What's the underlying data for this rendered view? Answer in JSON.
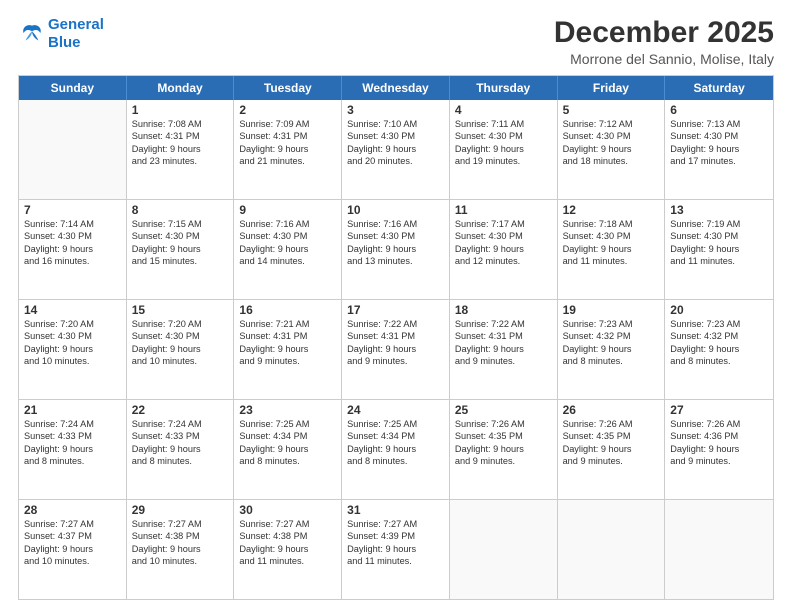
{
  "logo": {
    "line1": "General",
    "line2": "Blue"
  },
  "title": "December 2025",
  "subtitle": "Morrone del Sannio, Molise, Italy",
  "days_header": [
    "Sunday",
    "Monday",
    "Tuesday",
    "Wednesday",
    "Thursday",
    "Friday",
    "Saturday"
  ],
  "weeks": [
    [
      {
        "day": "",
        "lines": []
      },
      {
        "day": "1",
        "lines": [
          "Sunrise: 7:08 AM",
          "Sunset: 4:31 PM",
          "Daylight: 9 hours",
          "and 23 minutes."
        ]
      },
      {
        "day": "2",
        "lines": [
          "Sunrise: 7:09 AM",
          "Sunset: 4:31 PM",
          "Daylight: 9 hours",
          "and 21 minutes."
        ]
      },
      {
        "day": "3",
        "lines": [
          "Sunrise: 7:10 AM",
          "Sunset: 4:30 PM",
          "Daylight: 9 hours",
          "and 20 minutes."
        ]
      },
      {
        "day": "4",
        "lines": [
          "Sunrise: 7:11 AM",
          "Sunset: 4:30 PM",
          "Daylight: 9 hours",
          "and 19 minutes."
        ]
      },
      {
        "day": "5",
        "lines": [
          "Sunrise: 7:12 AM",
          "Sunset: 4:30 PM",
          "Daylight: 9 hours",
          "and 18 minutes."
        ]
      },
      {
        "day": "6",
        "lines": [
          "Sunrise: 7:13 AM",
          "Sunset: 4:30 PM",
          "Daylight: 9 hours",
          "and 17 minutes."
        ]
      }
    ],
    [
      {
        "day": "7",
        "lines": [
          "Sunrise: 7:14 AM",
          "Sunset: 4:30 PM",
          "Daylight: 9 hours",
          "and 16 minutes."
        ]
      },
      {
        "day": "8",
        "lines": [
          "Sunrise: 7:15 AM",
          "Sunset: 4:30 PM",
          "Daylight: 9 hours",
          "and 15 minutes."
        ]
      },
      {
        "day": "9",
        "lines": [
          "Sunrise: 7:16 AM",
          "Sunset: 4:30 PM",
          "Daylight: 9 hours",
          "and 14 minutes."
        ]
      },
      {
        "day": "10",
        "lines": [
          "Sunrise: 7:16 AM",
          "Sunset: 4:30 PM",
          "Daylight: 9 hours",
          "and 13 minutes."
        ]
      },
      {
        "day": "11",
        "lines": [
          "Sunrise: 7:17 AM",
          "Sunset: 4:30 PM",
          "Daylight: 9 hours",
          "and 12 minutes."
        ]
      },
      {
        "day": "12",
        "lines": [
          "Sunrise: 7:18 AM",
          "Sunset: 4:30 PM",
          "Daylight: 9 hours",
          "and 11 minutes."
        ]
      },
      {
        "day": "13",
        "lines": [
          "Sunrise: 7:19 AM",
          "Sunset: 4:30 PM",
          "Daylight: 9 hours",
          "and 11 minutes."
        ]
      }
    ],
    [
      {
        "day": "14",
        "lines": [
          "Sunrise: 7:20 AM",
          "Sunset: 4:30 PM",
          "Daylight: 9 hours",
          "and 10 minutes."
        ]
      },
      {
        "day": "15",
        "lines": [
          "Sunrise: 7:20 AM",
          "Sunset: 4:30 PM",
          "Daylight: 9 hours",
          "and 10 minutes."
        ]
      },
      {
        "day": "16",
        "lines": [
          "Sunrise: 7:21 AM",
          "Sunset: 4:31 PM",
          "Daylight: 9 hours",
          "and 9 minutes."
        ]
      },
      {
        "day": "17",
        "lines": [
          "Sunrise: 7:22 AM",
          "Sunset: 4:31 PM",
          "Daylight: 9 hours",
          "and 9 minutes."
        ]
      },
      {
        "day": "18",
        "lines": [
          "Sunrise: 7:22 AM",
          "Sunset: 4:31 PM",
          "Daylight: 9 hours",
          "and 9 minutes."
        ]
      },
      {
        "day": "19",
        "lines": [
          "Sunrise: 7:23 AM",
          "Sunset: 4:32 PM",
          "Daylight: 9 hours",
          "and 8 minutes."
        ]
      },
      {
        "day": "20",
        "lines": [
          "Sunrise: 7:23 AM",
          "Sunset: 4:32 PM",
          "Daylight: 9 hours",
          "and 8 minutes."
        ]
      }
    ],
    [
      {
        "day": "21",
        "lines": [
          "Sunrise: 7:24 AM",
          "Sunset: 4:33 PM",
          "Daylight: 9 hours",
          "and 8 minutes."
        ]
      },
      {
        "day": "22",
        "lines": [
          "Sunrise: 7:24 AM",
          "Sunset: 4:33 PM",
          "Daylight: 9 hours",
          "and 8 minutes."
        ]
      },
      {
        "day": "23",
        "lines": [
          "Sunrise: 7:25 AM",
          "Sunset: 4:34 PM",
          "Daylight: 9 hours",
          "and 8 minutes."
        ]
      },
      {
        "day": "24",
        "lines": [
          "Sunrise: 7:25 AM",
          "Sunset: 4:34 PM",
          "Daylight: 9 hours",
          "and 8 minutes."
        ]
      },
      {
        "day": "25",
        "lines": [
          "Sunrise: 7:26 AM",
          "Sunset: 4:35 PM",
          "Daylight: 9 hours",
          "and 9 minutes."
        ]
      },
      {
        "day": "26",
        "lines": [
          "Sunrise: 7:26 AM",
          "Sunset: 4:35 PM",
          "Daylight: 9 hours",
          "and 9 minutes."
        ]
      },
      {
        "day": "27",
        "lines": [
          "Sunrise: 7:26 AM",
          "Sunset: 4:36 PM",
          "Daylight: 9 hours",
          "and 9 minutes."
        ]
      }
    ],
    [
      {
        "day": "28",
        "lines": [
          "Sunrise: 7:27 AM",
          "Sunset: 4:37 PM",
          "Daylight: 9 hours",
          "and 10 minutes."
        ]
      },
      {
        "day": "29",
        "lines": [
          "Sunrise: 7:27 AM",
          "Sunset: 4:38 PM",
          "Daylight: 9 hours",
          "and 10 minutes."
        ]
      },
      {
        "day": "30",
        "lines": [
          "Sunrise: 7:27 AM",
          "Sunset: 4:38 PM",
          "Daylight: 9 hours",
          "and 11 minutes."
        ]
      },
      {
        "day": "31",
        "lines": [
          "Sunrise: 7:27 AM",
          "Sunset: 4:39 PM",
          "Daylight: 9 hours",
          "and 11 minutes."
        ]
      },
      {
        "day": "",
        "lines": []
      },
      {
        "day": "",
        "lines": []
      },
      {
        "day": "",
        "lines": []
      }
    ]
  ]
}
